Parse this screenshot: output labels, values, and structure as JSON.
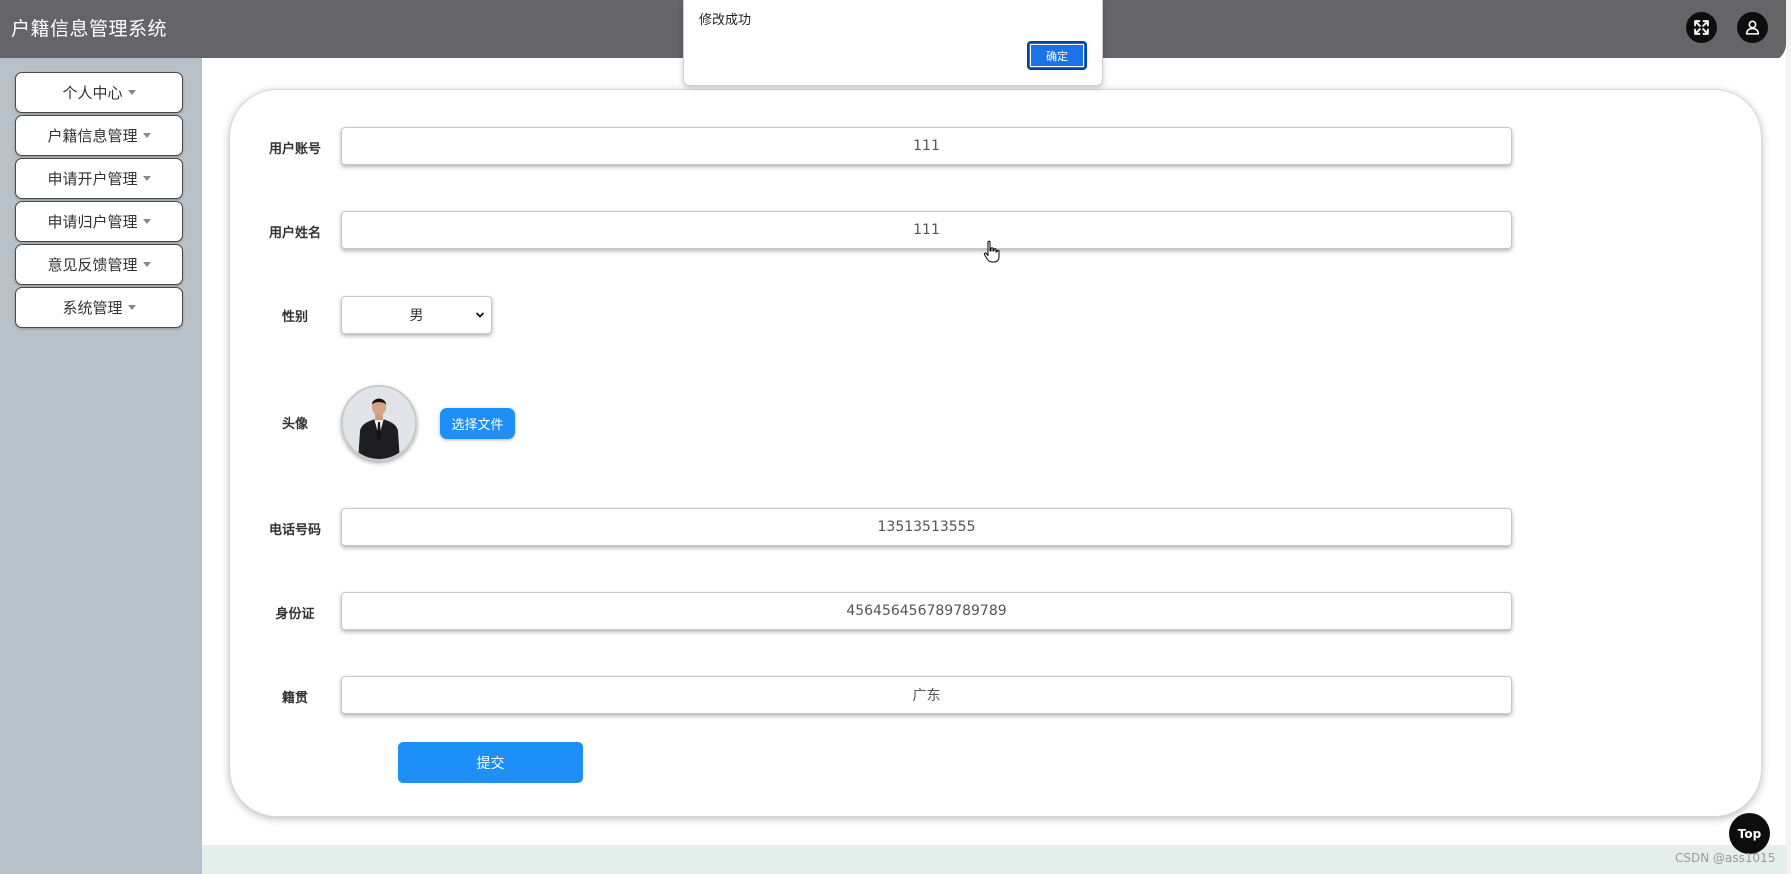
{
  "header": {
    "title": "户籍信息管理系统",
    "fullscreen_icon": "expand-icon",
    "user_icon": "user-icon"
  },
  "sidebar": {
    "items": [
      {
        "label": "个人中心"
      },
      {
        "label": "户籍信息管理"
      },
      {
        "label": "申请开户管理"
      },
      {
        "label": "申请归户管理"
      },
      {
        "label": "意见反馈管理"
      },
      {
        "label": "系统管理"
      }
    ]
  },
  "form": {
    "account": {
      "label": "用户账号",
      "value": "111"
    },
    "name": {
      "label": "用户姓名",
      "value": "111"
    },
    "gender": {
      "label": "性别",
      "value": "男"
    },
    "avatar": {
      "label": "头像",
      "upload_label": "选择文件"
    },
    "phone": {
      "label": "电话号码",
      "value": "13513513555"
    },
    "id_card": {
      "label": "身份证",
      "value": "456456456789789789"
    },
    "native_place": {
      "label": "籍贯",
      "value": "广东"
    },
    "submit_label": "提交"
  },
  "dialog": {
    "message": "修改成功",
    "ok_label": "确定"
  },
  "top_button": "Top",
  "watermark": "CSDN @ass1015",
  "colors": {
    "header_bg": "#646469",
    "sidebar_bg": "#b8c1c7",
    "primary": "#1e8ff6",
    "dialog_button": "#1a73e8"
  }
}
